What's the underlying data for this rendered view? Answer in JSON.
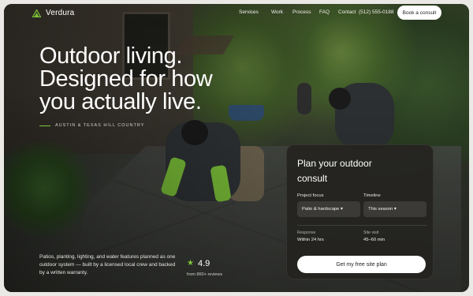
{
  "brand": {
    "name": "Verdura",
    "icon": "leaf-triangle-icon",
    "accent": "#7fc63a"
  },
  "nav": {
    "links": [
      "Services",
      "Work",
      "Process",
      "FAQ",
      "Contact"
    ],
    "phone": "(512) 555-0188",
    "cta_label": "Book a consult"
  },
  "hero": {
    "title_lines": [
      "Outdoor living.",
      "Designed for how",
      "you actually live."
    ],
    "location": "AUSTIN & TEXAS HILL COUNTRY",
    "description": "Patios, planting, lighting, and water features planned as one outdoor system — built by a licensed local crew and backed by a written warranty."
  },
  "rating": {
    "value": "4.9",
    "reviews": "from 860+ reviews",
    "icon": "star-icon"
  },
  "card": {
    "title": "Plan your outdoor consult",
    "project_focus": {
      "label": "Project focus",
      "value": "Patio & hardscape ▾"
    },
    "timeline": {
      "label": "Timeline",
      "value": "This season ▾"
    },
    "response": {
      "label": "Response",
      "value": "Within 24 hrs"
    },
    "site_visit": {
      "label": "Site visit",
      "value": "45–60 min"
    },
    "cta_label": "Get my free site plan"
  }
}
